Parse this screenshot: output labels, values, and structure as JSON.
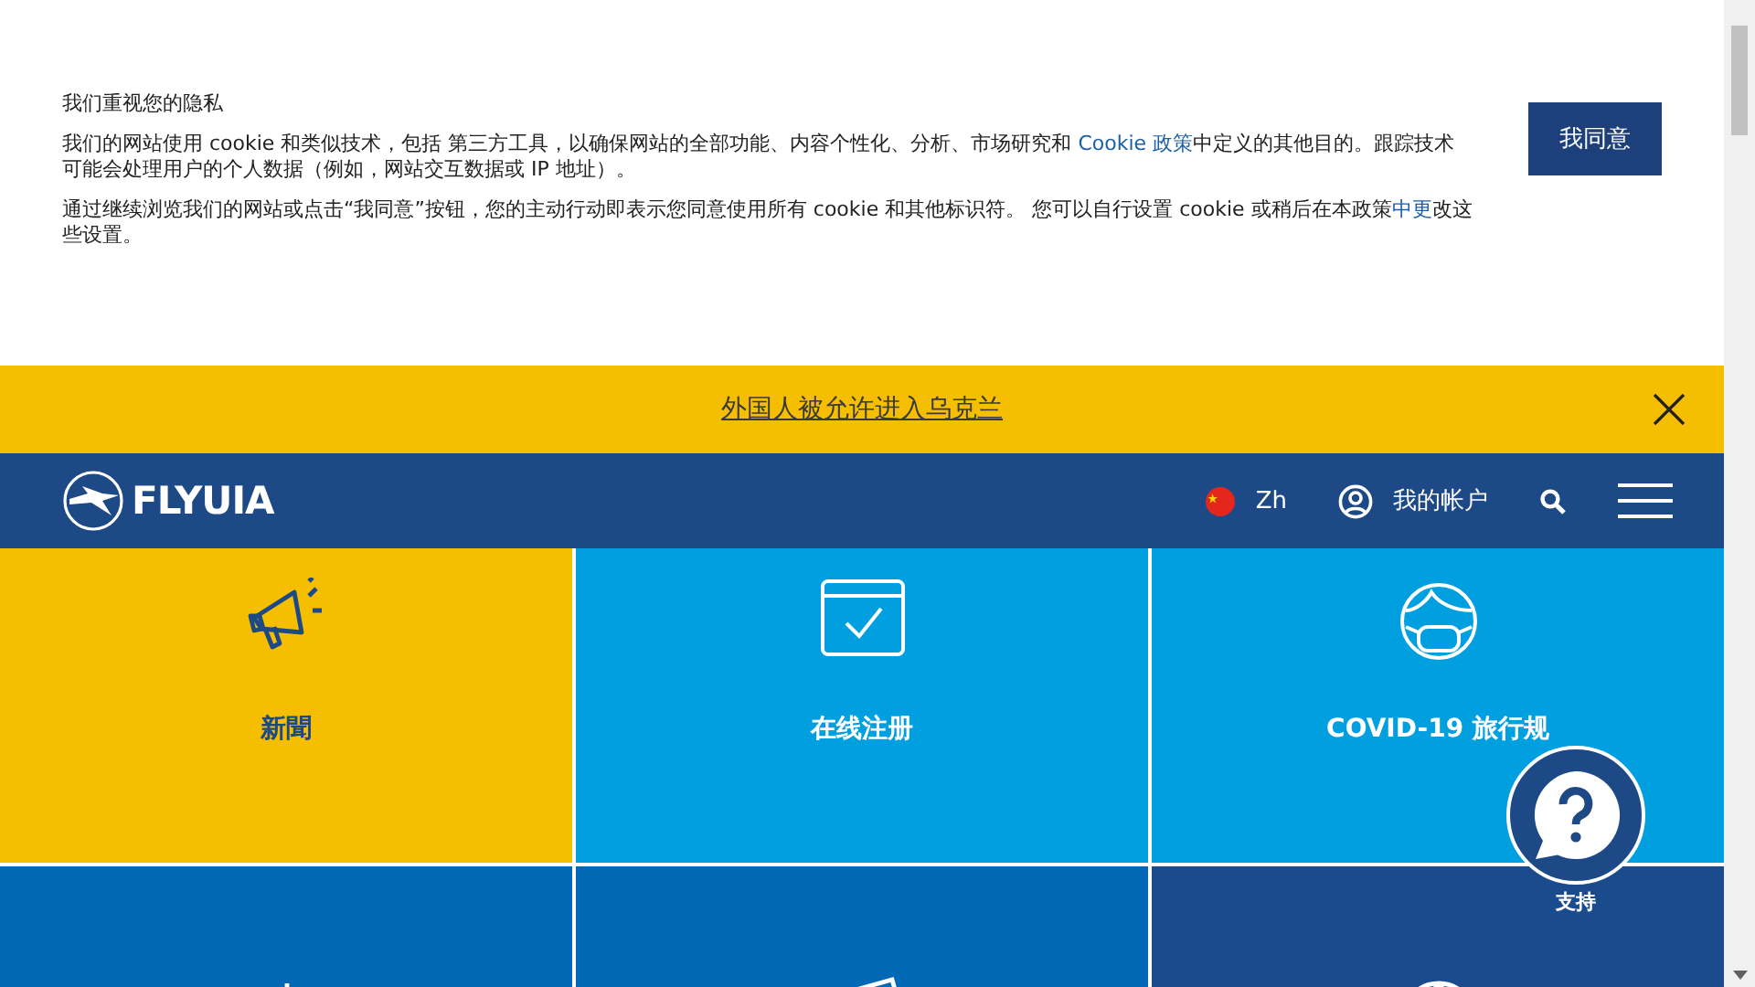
{
  "cookie_banner": {
    "title": "我们重视您的隐私",
    "paragraphs": [
      [
        {
          "kind": "text",
          "text": "我们的网站使用 cookie 和类似技术，包括 第三方工具，以确保网站的全部功能、内容个性化、分析、市场研究和 "
        },
        {
          "kind": "link",
          "text": "Cookie 政策"
        },
        {
          "kind": "text",
          "text": "中定义的其他目的。跟踪技术可能会处理用户的个人数据（例如，网站交互数据或 IP 地址）。"
        }
      ],
      [
        {
          "kind": "text",
          "text": "通过继续浏览我们的网站或点击“我同意”按钮，您的主动行动即表示您同意使用所有 cookie 和其他标识符。 您可以自行设置 cookie 或稍后在本政策"
        },
        {
          "kind": "link",
          "text": "中更"
        },
        {
          "kind": "text",
          "text": "改这些设置。"
        }
      ]
    ],
    "accept_button": "我同意"
  },
  "notice_bar": {
    "link": "外国人被允许进入乌克兰"
  },
  "header": {
    "logo": "FLYUIA",
    "language": "Zh",
    "account": "我的帐户"
  },
  "tiles": [
    {
      "kind": "news",
      "label": "新聞",
      "color": "#f5be00"
    },
    {
      "kind": "checkin",
      "label": "在线注册",
      "color": "#009fdf"
    },
    {
      "kind": "covid",
      "label": "COVID-19 旅行规",
      "color": "#009fdf"
    },
    {
      "kind": "gear",
      "color": "#0068b4"
    },
    {
      "kind": "ticket",
      "color": "#0068b4"
    },
    {
      "kind": "globe",
      "color": "#1a4b8c"
    }
  ],
  "support": {
    "label": "支持"
  }
}
